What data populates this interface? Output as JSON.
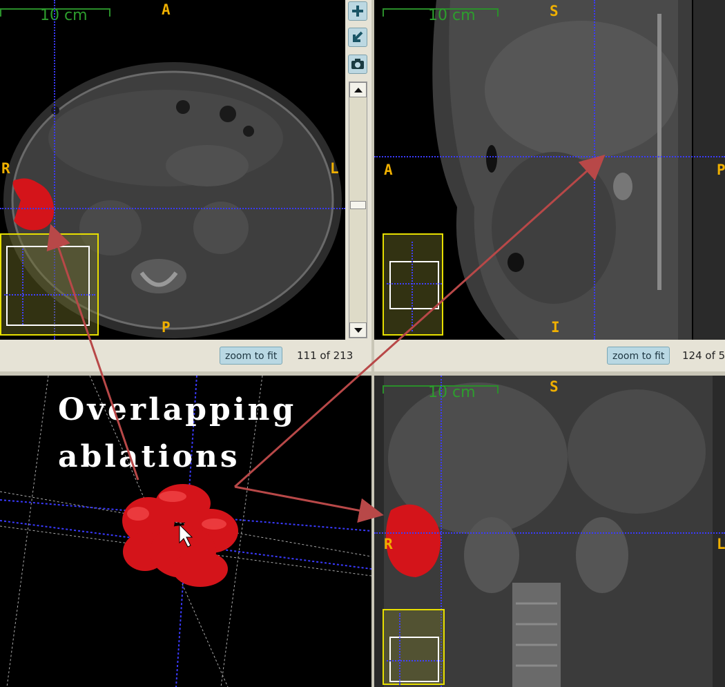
{
  "scale_label": "10 cm",
  "viewers": {
    "axial": {
      "orient_top": "A",
      "orient_bottom": "P",
      "orient_left": "R",
      "orient_right": "L",
      "slice": "111 of 213"
    },
    "sagittal": {
      "orient_top": "S",
      "orient_bottom": "I",
      "orient_left": "A",
      "orient_right": "P",
      "slice": "124 of 5"
    },
    "coronal": {
      "orient_top": "S",
      "orient_left": "R",
      "orient_right": "L"
    }
  },
  "zoom_label": "zoom to fit",
  "annotation": {
    "line1": "Overlapping",
    "line2": "ablations"
  },
  "toolbar": {
    "icons": [
      "plus-icon",
      "arrow-icon",
      "camera-icon"
    ]
  },
  "colors": {
    "ablation": "#d4141a",
    "crosshair": "#3a3aff",
    "orientation": "#f0b000",
    "scalebar": "#2a8f2a",
    "locator": "#e8e000",
    "arrow": "#b84848"
  }
}
